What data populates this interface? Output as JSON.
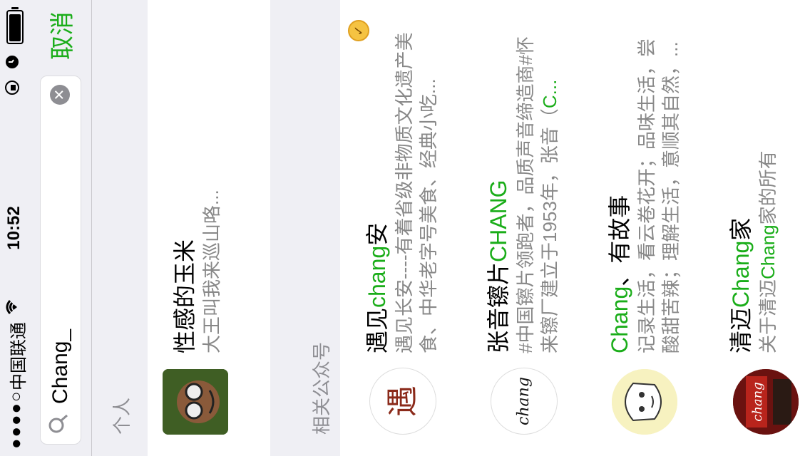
{
  "status": {
    "carrier": "中国联通",
    "signal_dots": "●●●●○",
    "time": "10:52"
  },
  "search": {
    "query": "Chang_",
    "cancel": "取消"
  },
  "personal": {
    "header": "个人",
    "item": {
      "title": "性感的玉米",
      "desc": "大王叫我来巡山咯..."
    }
  },
  "official": {
    "header": "相关公众号",
    "items": [
      {
        "title_pre": "遇见",
        "title_hl": "chang",
        "title_post": "安",
        "desc_pre": "遇见长安----有着省级非物质文化遗产美食、中华老字号美食、经典小吃...",
        "desc_hl": "",
        "avatar_text": "遇",
        "verified": "✓"
      },
      {
        "title_pre": "张音镲片",
        "title_hl": "CHANG",
        "title_post": "",
        "desc_pre": "#中国镲片领跑者，品质声音缔造商#怀来镲厂建立于1953年，张音（",
        "desc_hl": "C...",
        "avatar_text": "chang"
      },
      {
        "title_pre": "",
        "title_hl": "Chang",
        "title_post": "、有故事",
        "desc_pre": "记录生活，看云卷花开；品味生活，尝酸甜苦辣；理解生活，意顺其自然，...",
        "desc_hl": "",
        "avatar_text": ""
      },
      {
        "title_pre": "清迈",
        "title_hl": "Chang",
        "title_post": "家",
        "desc_pre": "关于清迈",
        "desc_hl": "Chang",
        "desc_post": "家的所有",
        "avatar_text": "chang"
      }
    ]
  }
}
